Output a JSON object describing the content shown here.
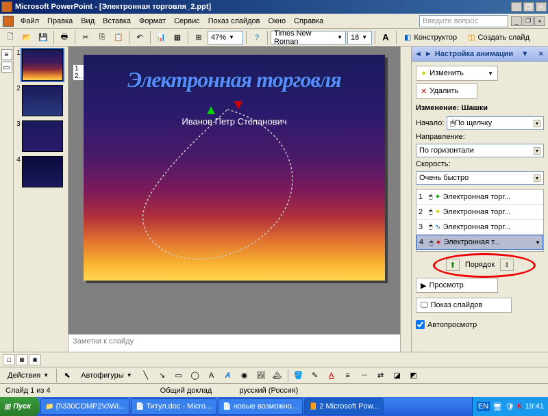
{
  "title": "Microsoft PowerPoint - [Электронная торговля_2.ppt]",
  "menu": [
    "Файл",
    "Правка",
    "Вид",
    "Вставка",
    "Формат",
    "Сервис",
    "Показ слайдов",
    "Окно",
    "Справка"
  ],
  "ask_placeholder": "Введите вопрос",
  "zoom": "47%",
  "font": "Times New Roman",
  "fontsize": "18",
  "designer": "Конструктор",
  "newslide": "Создать слайд",
  "thumbs": [
    1,
    2,
    3,
    4
  ],
  "slidetxtnums": "1\n2..",
  "slide": {
    "title": "Электронная торговля",
    "subtitle": "Иванов Петр Степанович"
  },
  "notes_placeholder": "Заметки к слайду",
  "taskpane": {
    "title": "Настройка анимации",
    "change": "Изменить",
    "delete": "Удалить",
    "changelabel": "Изменение: Шашки",
    "start": "Начало:",
    "startval": "По щелчку",
    "direction": "Направление:",
    "directionval": "По горизонтали",
    "speed": "Скорость:",
    "speedval": "Очень быстро",
    "anims": [
      {
        "n": "1",
        "label": "Электронная торг..."
      },
      {
        "n": "2",
        "label": "Электронная торг..."
      },
      {
        "n": "3",
        "label": "Электронная торг..."
      },
      {
        "n": "4",
        "label": "Электронная т..."
      }
    ],
    "order": "Порядок",
    "preview": "Просмотр",
    "slideshow": "Показ слайдов",
    "autopreview": "Автопросмотр"
  },
  "draw": {
    "actions": "Действия",
    "autoshapes": "Автофигуры"
  },
  "status": {
    "slide": "Слайд 1 из 4",
    "mid": "Общий доклад",
    "lang": "русский (Россия)"
  },
  "os": {
    "start": "Пуск",
    "tabs": [
      "{\\\\330COMP2\\c\\Wi...",
      "Титул.doc - Micro...",
      "новые возможно...",
      "2 Microsoft Pow..."
    ],
    "time": "19:41",
    "lang": "EN"
  }
}
